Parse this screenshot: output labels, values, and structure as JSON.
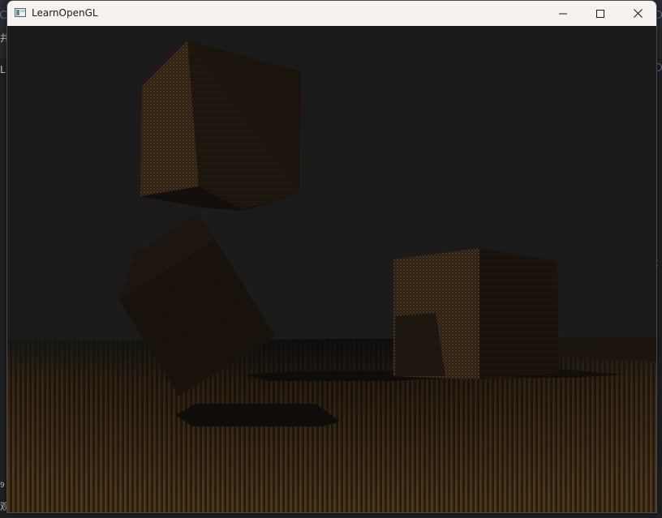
{
  "window": {
    "title": "LearnOpenGL",
    "buttons": {
      "minimize": "minimize-icon",
      "maximize": "maximize-icon",
      "close": "close-icon"
    }
  },
  "background": {
    "glyphs": [
      "井",
      "L",
      "9",
      "观",
      "t",
      ")"
    ]
  },
  "scene": {
    "description_colors": {
      "clear": "#1b1b1b",
      "wood": "#3a2a1a",
      "floor_light": "#6b4a22",
      "floor_dark": "#1a130b",
      "shadow": "#0e0d0b"
    }
  }
}
